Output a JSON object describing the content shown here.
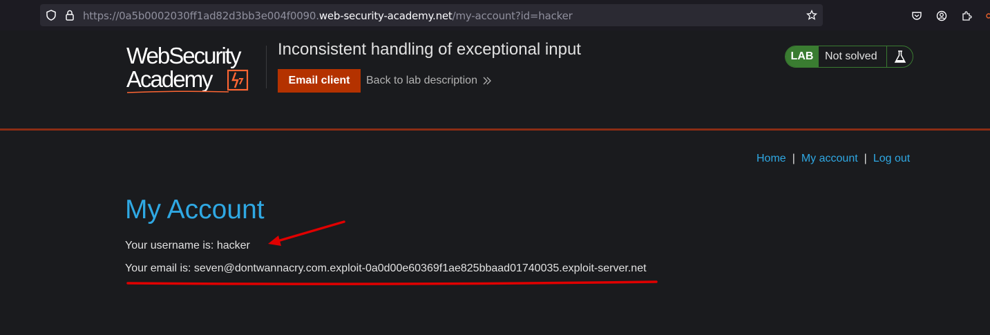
{
  "browser": {
    "url_prefix": "https://0a5b0002030ff1ad82d3bb3e004f0090.",
    "url_domain": "web-security-academy.net",
    "url_path": "/my-account?id=hacker"
  },
  "lab": {
    "logo_line1": "WebSecurity",
    "logo_line2": "Academy",
    "title": "Inconsistent handling of exceptional input",
    "email_client_label": "Email client",
    "back_label": "Back to lab description",
    "badge": "LAB",
    "status": "Not solved"
  },
  "nav": {
    "home": "Home",
    "my_account": "My account",
    "logout": "Log out",
    "separator": "|"
  },
  "account": {
    "heading": "My Account",
    "username_line": "Your username is: hacker",
    "email_line": "Your email is: seven@dontwannacry.com.exploit-0a0d00e60369f1ae825bbaad01740035.exploit-server.net"
  },
  "colors": {
    "accent_blue": "#2fa8e3",
    "email_button": "#b43200",
    "lab_green": "#3a7c31",
    "header_rule": "#8c2d14",
    "annotation_red": "#e00000"
  }
}
